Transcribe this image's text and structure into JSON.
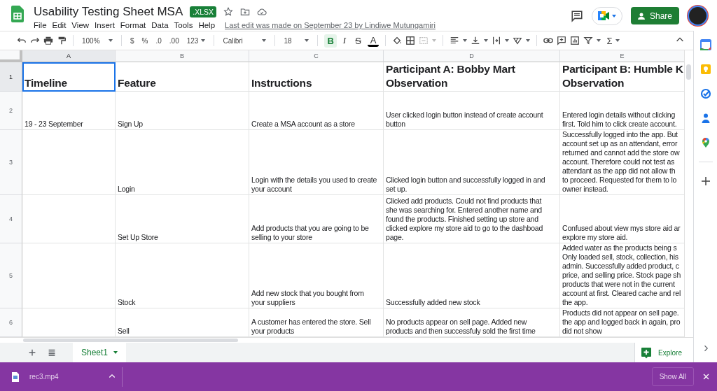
{
  "document": {
    "title": "Usability Testing Sheet MSA",
    "badge": ".XLSX",
    "last_edit": "Last edit was made on September 23 by Lindiwe Mutungamiri"
  },
  "menu": [
    "File",
    "Edit",
    "View",
    "Insert",
    "Format",
    "Data",
    "Tools",
    "Help"
  ],
  "share_button": "Share",
  "toolbar": {
    "zoom": "100%",
    "currency": "$",
    "percent": "%",
    "decimal_decrease": ".0",
    "decimal_increase": ".00",
    "number_format": "123",
    "font": "Calibri",
    "font_size": "18",
    "styles": [
      {
        "label": "B",
        "kind": "bold",
        "on": true
      },
      {
        "label": "I",
        "kind": "italic",
        "on": false
      },
      {
        "label": "S",
        "kind": "strike",
        "on": false
      },
      {
        "label": "A",
        "kind": "color",
        "on": false
      }
    ],
    "sum": "Σ"
  },
  "grid": {
    "columns": [
      {
        "label": "A",
        "selected": true
      },
      {
        "label": "B",
        "selected": false
      },
      {
        "label": "C",
        "selected": false
      },
      {
        "label": "D",
        "selected": false
      },
      {
        "label": "E",
        "selected": false
      }
    ],
    "rows": [
      {
        "number": "1",
        "kind": "header",
        "selected": true,
        "cells": [
          {
            "lines": [
              "Timeline"
            ],
            "selected": true
          },
          {
            "lines": [
              "Feature"
            ],
            "selected": false
          },
          {
            "lines": [
              "Instructions"
            ],
            "selected": false
          },
          {
            "lines": [
              "Participant A: Bobby Mart",
              "Observation"
            ],
            "selected": false
          },
          {
            "lines": [
              "Participant B: Humble K",
              "Observation"
            ],
            "selected": false
          }
        ]
      },
      {
        "number": "2",
        "kind": "data",
        "selected": false,
        "cells": [
          {
            "lines": [
              "19 - 23 September"
            ],
            "selected": false
          },
          {
            "lines": [
              "Sign Up"
            ],
            "selected": false
          },
          {
            "lines": [
              "Create a MSA account as a store"
            ],
            "selected": false
          },
          {
            "lines": [
              "User clicked login button instead of create account",
              "button"
            ],
            "selected": false
          },
          {
            "lines": [
              "Entered login details without clicking",
              "first. Told him to click create account."
            ],
            "selected": false
          }
        ]
      },
      {
        "number": "3",
        "kind": "data",
        "selected": false,
        "cells": [
          {
            "selected": false
          },
          {
            "lines": [
              "Login"
            ],
            "selected": false
          },
          {
            "lines": [
              "Login with the details you used to create",
              "your account"
            ],
            "selected": false
          },
          {
            "lines": [
              "Clicked login button and successfully logged in and",
              "set up."
            ],
            "selected": false
          },
          {
            "lines": [
              "Successfully logged into the app. But",
              "account set up as an attendant, error",
              "returned and cannot add the store ow",
              "account. Therefore could not test as",
              "attendant as the app did not allow th",
              "to proceed. Requested for them to lo",
              "owner instead."
            ],
            "selected": false
          }
        ]
      },
      {
        "number": "4",
        "kind": "data",
        "selected": false,
        "cells": [
          {
            "selected": false
          },
          {
            "lines": [
              "Set Up Store"
            ],
            "selected": false
          },
          {
            "lines": [
              "Add products that you are going to be",
              "selling to your store"
            ],
            "selected": false
          },
          {
            "lines": [
              "Clicked add products. Could not find products that",
              "she was searching for. Entered another name and",
              "found the products. Finished setting up store and",
              "clicked explore my store aid to go to the dashboad",
              "page."
            ],
            "selected": false
          },
          {
            "lines": [
              "Confused about view mys store aid ar",
              "explore my store aid."
            ],
            "selected": false
          }
        ]
      },
      {
        "number": "5",
        "kind": "data",
        "selected": false,
        "cells": [
          {
            "selected": false
          },
          {
            "lines": [
              "Stock"
            ],
            "selected": false
          },
          {
            "lines": [
              "Add new stock that you bought from",
              "your suppliers"
            ],
            "selected": false
          },
          {
            "lines": [
              "Successfully added new stock"
            ],
            "selected": false
          },
          {
            "lines": [
              "Added water as the products being s",
              "Only loaded sell, stock, collection, his",
              "admin. Successfully added product, c",
              "price, and selling price. Stock page sh",
              "products that were not in the current",
              "account at first. Cleared cache and rel",
              "the app."
            ],
            "selected": false
          }
        ]
      },
      {
        "number": "6",
        "kind": "data",
        "selected": false,
        "cells": [
          {
            "selected": false
          },
          {
            "lines": [
              "Sell"
            ],
            "selected": false
          },
          {
            "lines": [
              "A customer has entered the store. Sell",
              "your products"
            ],
            "selected": false
          },
          {
            "lines": [
              "No products appear on sell page. Added new",
              "products and then successfuly sold the first time"
            ],
            "selected": false
          },
          {
            "lines": [
              "Products did not appear on sell page.",
              "the app and logged back in again, pro",
              "did not show"
            ],
            "selected": false
          }
        ]
      }
    ]
  },
  "sheet_tabs": [
    {
      "label": "Sheet1",
      "selected": true
    }
  ],
  "explore_button": "Explore",
  "downloads": {
    "file": "rec3.mp4",
    "show_all": "Show All"
  }
}
